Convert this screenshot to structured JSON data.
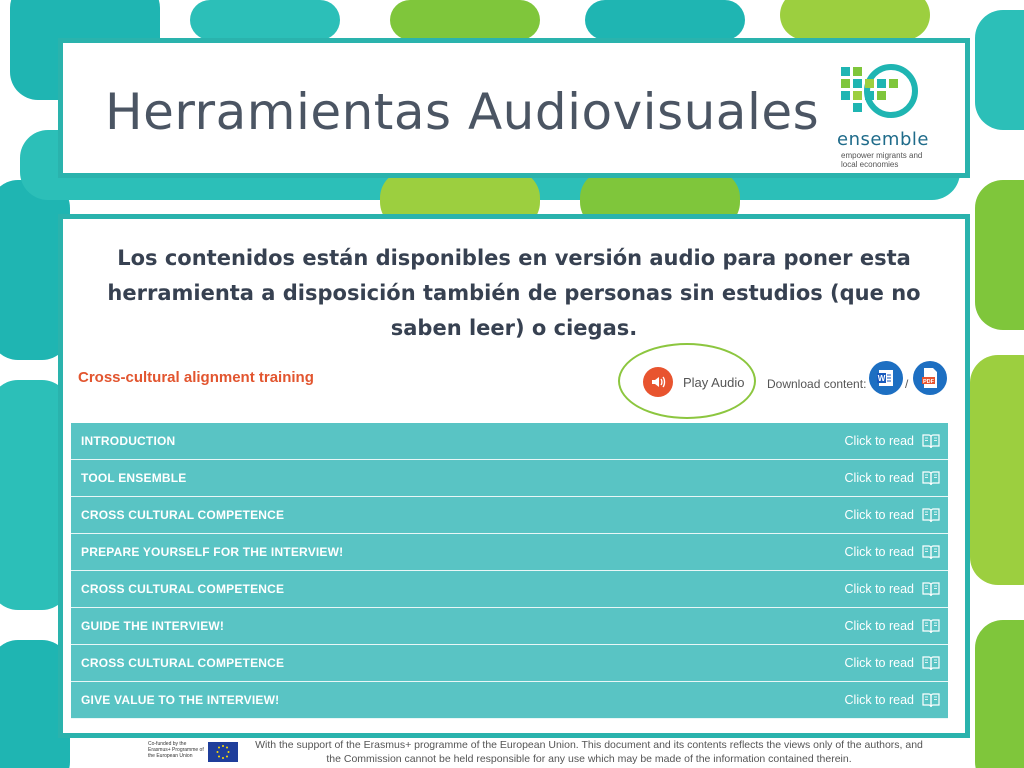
{
  "title": "Herramientas Audiovisuales",
  "logo": {
    "word": "ensemble",
    "tagline": "empower migrants and local economies"
  },
  "description": "Los contenidos están disponibles en versión audio para poner esta herramienta a disposición también de personas sin estudios (que no saben leer) o ciegas.",
  "course": {
    "title": "Cross-cultural alignment training",
    "play_audio": "Play Audio",
    "download_label": "Download content:",
    "download_separator": "/",
    "icons": {
      "audio": "speaker-icon",
      "word": "word-file-icon",
      "pdf": "pdf-file-icon",
      "read": "book-icon"
    }
  },
  "rows": [
    {
      "label": "INTRODUCTION",
      "action": "Click to read"
    },
    {
      "label": "TOOL ENSEMBLE",
      "action": "Click to read"
    },
    {
      "label": "CROSS CULTURAL COMPETENCE",
      "action": "Click to read"
    },
    {
      "label": "PREPARE YOURSELF FOR THE INTERVIEW!",
      "action": "Click to read"
    },
    {
      "label": "CROSS CULTURAL COMPETENCE",
      "action": "Click to read"
    },
    {
      "label": "GUIDE THE INTERVIEW!",
      "action": "Click to read"
    },
    {
      "label": "CROSS CULTURAL COMPETENCE",
      "action": "Click to read"
    },
    {
      "label": "GIVE VALUE TO THE INTERVIEW!",
      "action": "Click to read"
    }
  ],
  "footer": {
    "eu_text": "Co-funded by the Erasmus+ Programme of the European Union",
    "disclaimer": "With the support of the Erasmus+ programme of the European Union. This document and its contents reflects the views only of the authors, and the Commission cannot be held responsible for any use which may be made of the information contained therein."
  },
  "colors": {
    "accent": "#2ab3ad",
    "row": "#59c4c4",
    "orange": "#e2552f",
    "green": "#8cc63f"
  }
}
